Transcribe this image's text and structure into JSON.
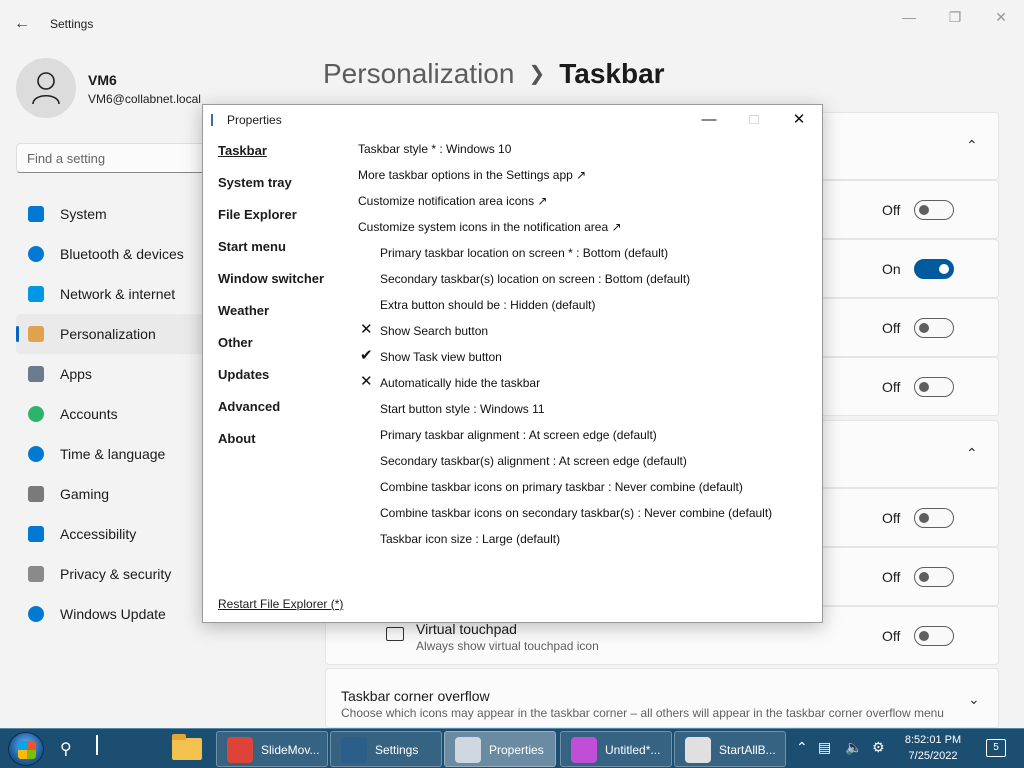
{
  "settings": {
    "title": "Settings",
    "user": {
      "name": "VM6",
      "email": "VM6@collabnet.local"
    },
    "search_placeholder": "Find a setting",
    "nav": [
      {
        "label": "System",
        "icon": "monitor-icon",
        "color": "#0078d4"
      },
      {
        "label": "Bluetooth & devices",
        "icon": "bluetooth-icon",
        "color": "#0078d4"
      },
      {
        "label": "Network & internet",
        "icon": "wifi-icon",
        "color": "#0097e6"
      },
      {
        "label": "Personalization",
        "icon": "brush-icon",
        "color": "#e0a34b"
      },
      {
        "label": "Apps",
        "icon": "apps-icon",
        "color": "#6a7c8c"
      },
      {
        "label": "Accounts",
        "icon": "person-icon",
        "color": "#2db36c"
      },
      {
        "label": "Time & language",
        "icon": "clock-globe-icon",
        "color": "#0078d4"
      },
      {
        "label": "Gaming",
        "icon": "gamepad-icon",
        "color": "#7a7a7a"
      },
      {
        "label": "Accessibility",
        "icon": "accessibility-icon",
        "color": "#0078d4"
      },
      {
        "label": "Privacy & security",
        "icon": "shield-icon",
        "color": "#8a8a8a"
      },
      {
        "label": "Windows Update",
        "icon": "update-icon",
        "color": "#0078d4"
      }
    ],
    "active_nav": "Personalization",
    "breadcrumb": {
      "parent": "Personalization",
      "current": "Taskbar"
    },
    "toggles": [
      {
        "state": "Off",
        "on": false
      },
      {
        "state": "On",
        "on": true
      },
      {
        "state": "Off",
        "on": false
      },
      {
        "state": "Off",
        "on": false
      },
      {
        "state": "Off",
        "on": false
      },
      {
        "state": "Off",
        "on": false
      },
      {
        "state": "Off",
        "on": false
      }
    ],
    "touchpad": {
      "title": "Virtual touchpad",
      "subtitle": "Always show virtual touchpad icon"
    },
    "overflow": {
      "title": "Taskbar corner overflow",
      "subtitle": "Choose which icons may appear in the taskbar corner – all others will appear in the taskbar corner overflow menu"
    }
  },
  "properties": {
    "title": "Properties",
    "nav": [
      "Taskbar",
      "System tray",
      "File Explorer",
      "Start menu",
      "Window switcher",
      "Weather",
      "Other",
      "Updates",
      "Advanced",
      "About"
    ],
    "selected": "Taskbar",
    "items": [
      {
        "text": "Taskbar style * : Windows 10",
        "indent": false,
        "mark": ""
      },
      {
        "text": "More taskbar options in the Settings app ↗",
        "indent": false,
        "mark": ""
      },
      {
        "text": "Customize notification area icons ↗",
        "indent": false,
        "mark": ""
      },
      {
        "text": "Customize system icons in the notification area ↗",
        "indent": false,
        "mark": ""
      },
      {
        "text": "Primary taskbar location on screen * : Bottom (default)",
        "indent": true,
        "mark": ""
      },
      {
        "text": "Secondary taskbar(s) location on screen : Bottom (default)",
        "indent": true,
        "mark": ""
      },
      {
        "text": "Extra button should be : Hidden (default)",
        "indent": true,
        "mark": ""
      },
      {
        "text": "Show Search button",
        "indent": true,
        "mark": "✕"
      },
      {
        "text": "Show Task view button",
        "indent": true,
        "mark": "✔"
      },
      {
        "text": "Automatically hide the taskbar",
        "indent": true,
        "mark": "✕"
      },
      {
        "text": "Start button style : Windows 11",
        "indent": true,
        "mark": ""
      },
      {
        "text": "Primary taskbar alignment : At screen edge (default)",
        "indent": true,
        "mark": ""
      },
      {
        "text": "Secondary taskbar(s) alignment : At screen edge (default)",
        "indent": true,
        "mark": ""
      },
      {
        "text": "Combine taskbar icons on primary taskbar : Never combine (default)",
        "indent": true,
        "mark": ""
      },
      {
        "text": "Combine taskbar icons on secondary taskbar(s) : Never combine (default)",
        "indent": true,
        "mark": ""
      },
      {
        "text": "Taskbar icon size : Large (default)",
        "indent": true,
        "mark": ""
      }
    ],
    "restart": "Restart File Explorer (*)"
  },
  "taskbar": {
    "apps": [
      {
        "label": "SlideMov...",
        "icon": "chrome-icon",
        "color": "#db4437"
      },
      {
        "label": "Settings",
        "icon": "settings-gear-icon",
        "color": "#2b5f8a"
      },
      {
        "label": "Properties",
        "icon": "properties-icon",
        "color": "#cfd8e0"
      },
      {
        "label": "Untitled*...",
        "icon": "paint-icon",
        "color": "#c04fd6"
      },
      {
        "label": "StartAllB...",
        "icon": "startallback-icon",
        "color": "#e0e0e0"
      }
    ],
    "active_app": "Properties",
    "time": "8:52:01 PM",
    "date": "7/25/2022",
    "notifications": "5"
  }
}
